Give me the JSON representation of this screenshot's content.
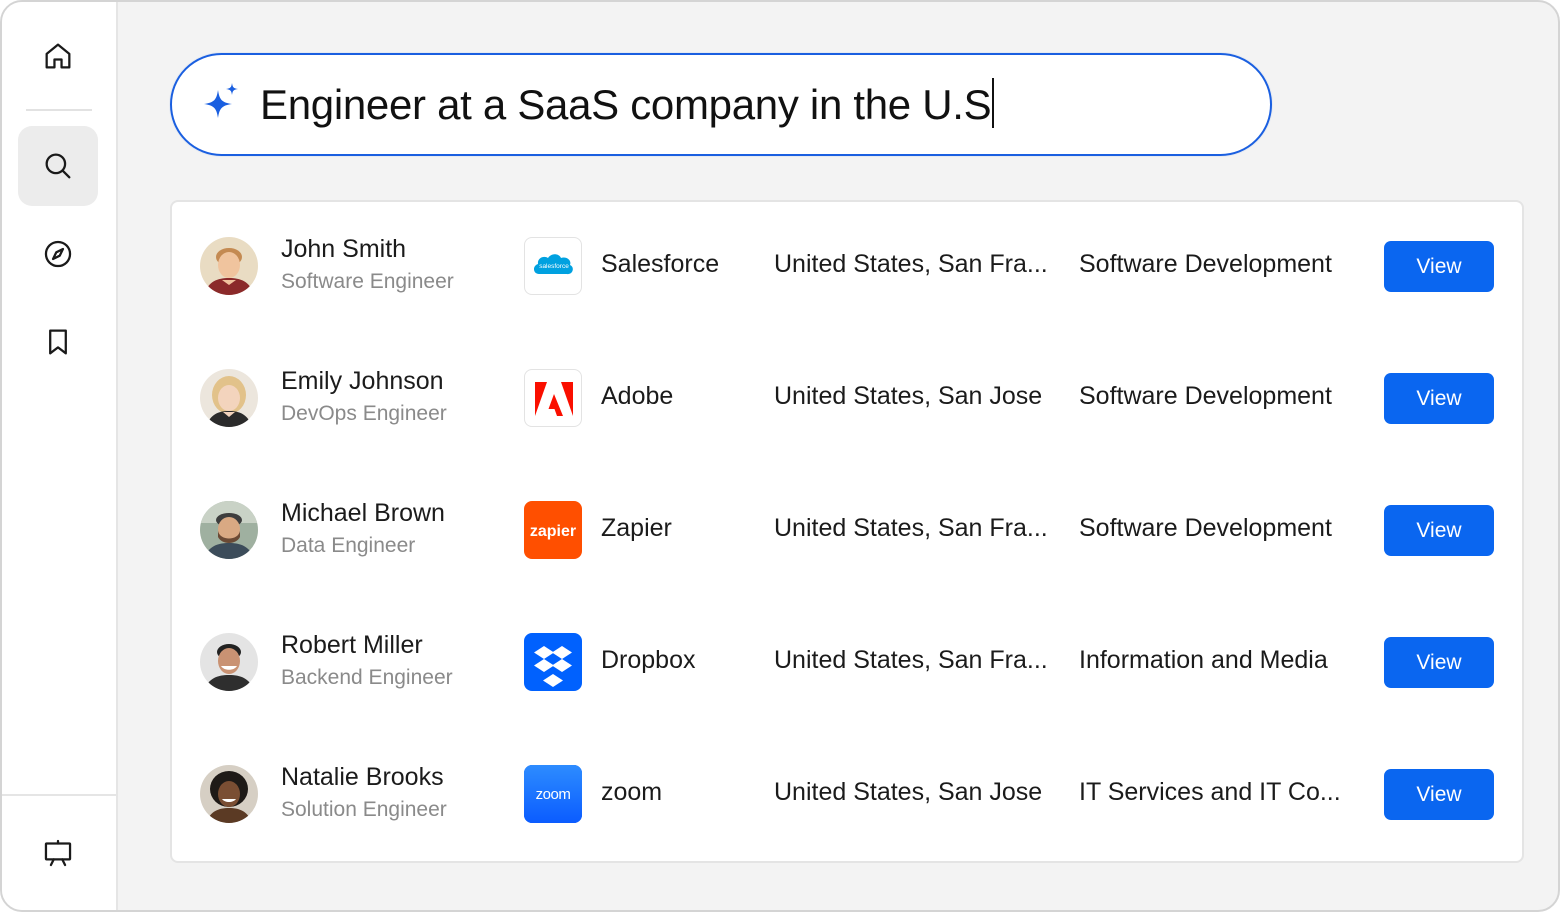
{
  "sidebar": {
    "items": [
      {
        "icon": "home-icon"
      },
      {
        "icon": "search-icon",
        "active": true
      },
      {
        "icon": "compass-icon"
      },
      {
        "icon": "bookmark-icon"
      }
    ],
    "bottom_icon": "presentation-icon"
  },
  "search": {
    "icon": "sparkle-icon",
    "query": "Engineer at a SaaS company in the U.S"
  },
  "colors": {
    "accent": "#0a66f0",
    "search_border": "#1a5fe0",
    "salesforce": "#00a1e0",
    "adobe": "#fa0f00",
    "zapier": "#ff4f00",
    "dropbox": "#0061fe",
    "zoom": "#0b5cff"
  },
  "results": [
    {
      "name": "John Smith",
      "title": "Software Engineer",
      "company": "Salesforce",
      "logo_text": "salesforce",
      "location": "United States, San Fra...",
      "industry": "Software Development",
      "action": "View"
    },
    {
      "name": "Emily Johnson",
      "title": "DevOps Engineer",
      "company": "Adobe",
      "logo_text": "",
      "location": "United States, San Jose",
      "industry": "Software Development",
      "action": "View"
    },
    {
      "name": "Michael Brown",
      "title": "Data Engineer",
      "company": "Zapier",
      "logo_text": "zapier",
      "location": "United States, San Fra...",
      "industry": "Software Development",
      "action": "View"
    },
    {
      "name": "Robert Miller",
      "title": "Backend Engineer",
      "company": "Dropbox",
      "logo_text": "",
      "location": "United States, San Fra...",
      "industry": "Information and Media",
      "action": "View"
    },
    {
      "name": "Natalie Brooks",
      "title": "Solution Engineer",
      "company": "zoom",
      "logo_text": "zoom",
      "location": "United States, San Jose",
      "industry": "IT Services and IT Co...",
      "action": "View"
    }
  ]
}
